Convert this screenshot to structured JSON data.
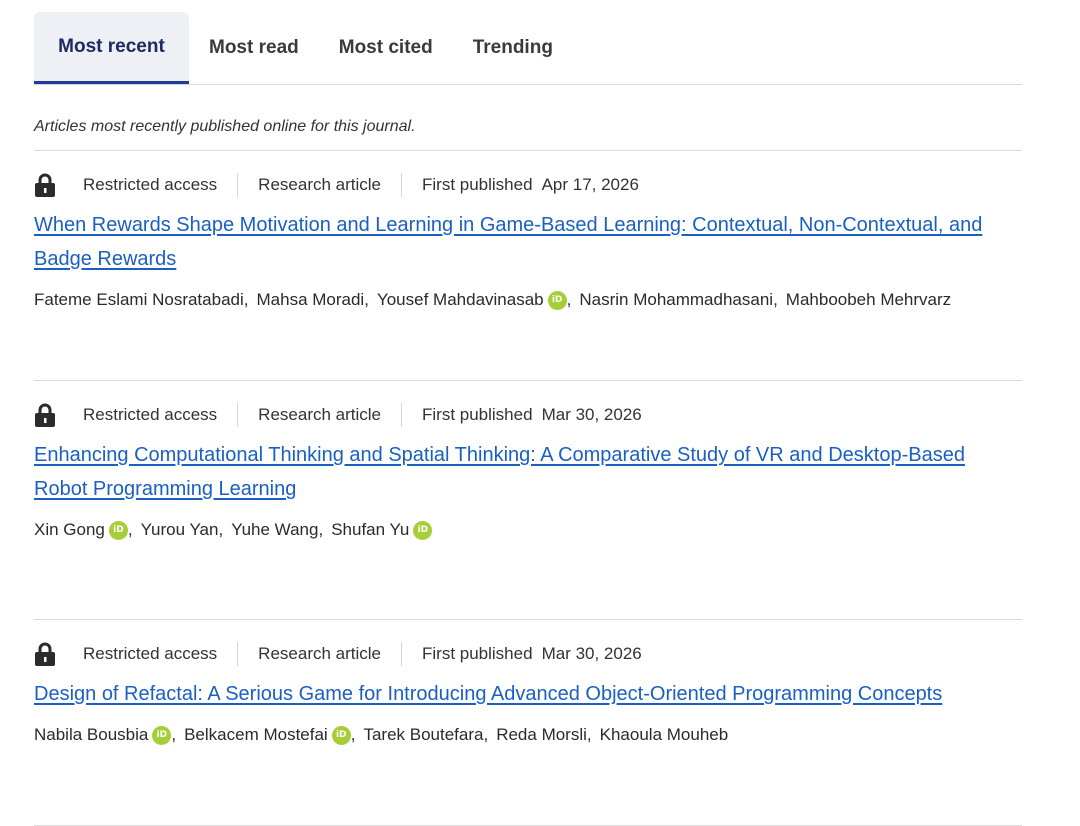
{
  "tabs": [
    {
      "label": "Most recent",
      "active": true
    },
    {
      "label": "Most read",
      "active": false
    },
    {
      "label": "Most cited",
      "active": false
    },
    {
      "label": "Trending",
      "active": false
    }
  ],
  "intro": "Articles most recently published online for this journal.",
  "colors": {
    "link": "#1a5fc2",
    "tab_active": "#1c2a63",
    "orcid": "#a6ce39"
  },
  "articles": [
    {
      "access": "Restricted access",
      "type": "Research article",
      "published_label": "First published",
      "date": "Apr 17, 2026",
      "title": "When Rewards Shape Motivation and Learning in Game-Based Learning: Contextual, Non-Contextual, and Badge Rewards",
      "authors": [
        {
          "name": "Fateme Eslami Nosratabadi",
          "orcid": false
        },
        {
          "name": "Mahsa Moradi",
          "orcid": false
        },
        {
          "name": "Yousef Mahdavinasab",
          "orcid": true
        },
        {
          "name": "Nasrin Mohammadhasani",
          "orcid": false
        },
        {
          "name": "Mahboobeh Mehrvarz",
          "orcid": false
        }
      ]
    },
    {
      "access": "Restricted access",
      "type": "Research article",
      "published_label": "First published",
      "date": "Mar 30, 2026",
      "title": "Enhancing Computational Thinking and Spatial Thinking: A Comparative Study of VR and Desktop-Based Robot Programming Learning",
      "authors": [
        {
          "name": "Xin Gong",
          "orcid": true
        },
        {
          "name": "Yurou Yan",
          "orcid": false
        },
        {
          "name": "Yuhe Wang",
          "orcid": false
        },
        {
          "name": "Shufan Yu",
          "orcid": true
        }
      ]
    },
    {
      "access": "Restricted access",
      "type": "Research article",
      "published_label": "First published",
      "date": "Mar 30, 2026",
      "title": "Design of Refactal: A Serious Game for Introducing Advanced Object-Oriented Programming Concepts",
      "authors": [
        {
          "name": "Nabila Bousbia",
          "orcid": true
        },
        {
          "name": "Belkacem Mostefai",
          "orcid": true
        },
        {
          "name": "Tarek Boutefara",
          "orcid": false
        },
        {
          "name": "Reda Morsli",
          "orcid": false
        },
        {
          "name": "Khaoula Mouheb",
          "orcid": false
        }
      ]
    }
  ]
}
